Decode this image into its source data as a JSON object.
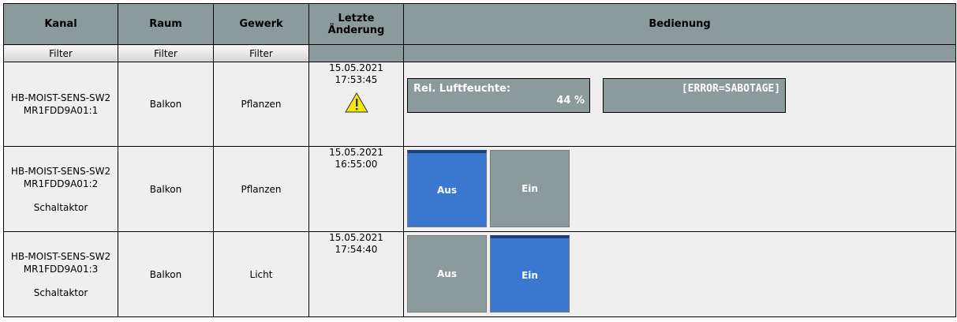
{
  "columns": {
    "kanal": "Kanal",
    "raum": "Raum",
    "gewerk": "Gewerk",
    "letzte_line1": "Letzte",
    "letzte_line2": "Änderung",
    "bedienung": "Bedienung"
  },
  "filters": {
    "kanal": "Filter",
    "raum": "Filter",
    "gewerk": "Filter"
  },
  "rows": [
    {
      "device": "HB-MOIST-SENS-SW2",
      "address": "MR1FDD9A01:1",
      "type": "",
      "raum": "Balkon",
      "gewerk": "Pflanzen",
      "date": "15.05.2021",
      "time": "17:53:45",
      "warning_icon": "warning-triangle-icon",
      "humidity_label": "Rel. Luftfeuchte:",
      "humidity_value": "44 %",
      "error_text": "[ERROR=SABOTAGE]"
    },
    {
      "device": "HB-MOIST-SENS-SW2",
      "address": "MR1FDD9A01:2",
      "type": "Schaltaktor",
      "raum": "Balkon",
      "gewerk": "Pflanzen",
      "date": "15.05.2021",
      "time": "16:55:00",
      "button_off": "Aus",
      "button_on": "Ein",
      "state": "Aus"
    },
    {
      "device": "HB-MOIST-SENS-SW2",
      "address": "MR1FDD9A01:3",
      "type": "Schaltaktor",
      "raum": "Balkon",
      "gewerk": "Licht",
      "date": "15.05.2021",
      "time": "17:54:40",
      "button_off": "Aus",
      "button_on": "Ein",
      "state": "Ein"
    }
  ],
  "colors": {
    "header": "#8b9a9a",
    "active": "#3a78cf",
    "row_bg": "#efefef"
  }
}
